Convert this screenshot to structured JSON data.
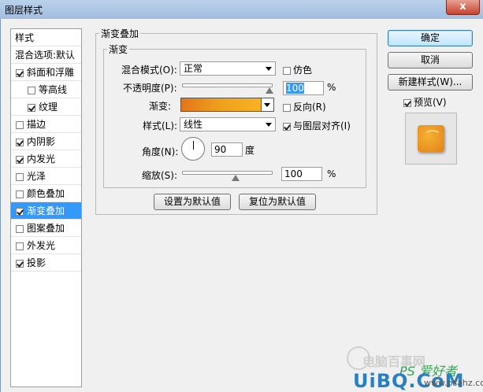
{
  "window": {
    "title": "图层样式",
    "close_glyph": "x"
  },
  "style_list": {
    "items": [
      {
        "label": "样式",
        "type": "header"
      },
      {
        "label": "混合选项:默认",
        "type": "header"
      },
      {
        "label": "斜面和浮雕",
        "checked": true
      },
      {
        "label": "等高线",
        "checked": false,
        "sub": true
      },
      {
        "label": "纹理",
        "checked": true,
        "sub": true
      },
      {
        "label": "描边",
        "checked": false
      },
      {
        "label": "内阴影",
        "checked": true
      },
      {
        "label": "内发光",
        "checked": true
      },
      {
        "label": "光泽",
        "checked": false
      },
      {
        "label": "颜色叠加",
        "checked": false
      },
      {
        "label": "渐变叠加",
        "checked": true,
        "selected": true
      },
      {
        "label": "图案叠加",
        "checked": false
      },
      {
        "label": "外发光",
        "checked": false
      },
      {
        "label": "投影",
        "checked": true
      }
    ]
  },
  "panel": {
    "outer_title": "渐变叠加",
    "inner_title": "渐变",
    "blend_mode": {
      "label": "混合模式(O):",
      "value": "正常"
    },
    "dither": {
      "label": "仿色",
      "checked": false
    },
    "opacity": {
      "label": "不透明度(P):",
      "value": "100",
      "unit": "%",
      "level": 1.0
    },
    "gradient": {
      "label": "渐变:",
      "colors": [
        "#e2761a",
        "#f0a11c",
        "#f7b321"
      ]
    },
    "reverse": {
      "label": "反向(R)",
      "checked": false
    },
    "style": {
      "label": "样式(L):",
      "value": "线性"
    },
    "align_with_layer": {
      "label": "与图层对齐(I)",
      "checked": true
    },
    "angle": {
      "label": "角度(N):",
      "value": "90",
      "unit": "度"
    },
    "scale": {
      "label": "缩放(S):",
      "value": "100",
      "unit": "%",
      "level": 0.5
    },
    "make_default_button": "设置为默认值",
    "reset_default_button": "复位为默认值"
  },
  "actions": {
    "ok": "确定",
    "cancel": "取消",
    "new_style": "新建样式(W)...",
    "preview": {
      "label": "预览(V)",
      "checked": true
    }
  },
  "watermark": {
    "line1": "电脑百事网",
    "line2": "PS 爱好者",
    "line3": "UiBQ.CoM",
    "line4": "www.psahz.com"
  }
}
